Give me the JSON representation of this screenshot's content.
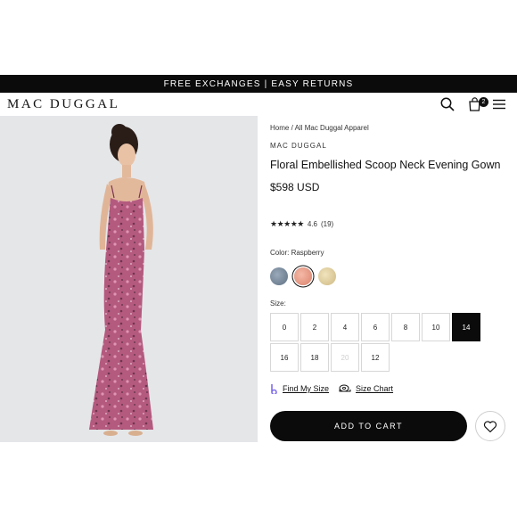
{
  "promo": {
    "text": "FREE EXCHANGES | EASY RETURNS"
  },
  "header": {
    "logo": "MAC DUGGAL",
    "icons": [
      "search-icon",
      "shopping-bag-icon",
      "hamburger-menu-icon"
    ],
    "cart_count": "2"
  },
  "product": {
    "breadcrumb": {
      "home": "Home",
      "separator": "/",
      "category": "All Mac Duggal Apparel"
    },
    "brand": "MAC DUGGAL",
    "title": "Floral Embellished Scoop Neck Evening Gown",
    "price": "$598 USD",
    "rating": {
      "stars": "★★★★★",
      "score": "4.6",
      "count": "(19)"
    },
    "color_label": "Color: Raspberry",
    "swatches": [
      {
        "name": "blue-grey",
        "color": "#7c8ea0"
      },
      {
        "name": "raspberry",
        "color": "#e6a38e",
        "selected": true
      },
      {
        "name": "gold",
        "color": "#e3d3a6"
      }
    ],
    "size_label": "Size:",
    "sizes": [
      "0",
      "2",
      "4",
      "6",
      "8",
      "10",
      "14",
      "16",
      "18",
      "20",
      "12"
    ],
    "selected_size": "14",
    "unavailable_size": "20",
    "find_my_size": "Find My Size",
    "size_chart": "Size Chart",
    "add_to_cart": "ADD TO CART"
  },
  "colors": {
    "accent": "#0b0b0b",
    "photo_bg": "#e5e6e8",
    "dress": "#b45a7f"
  }
}
